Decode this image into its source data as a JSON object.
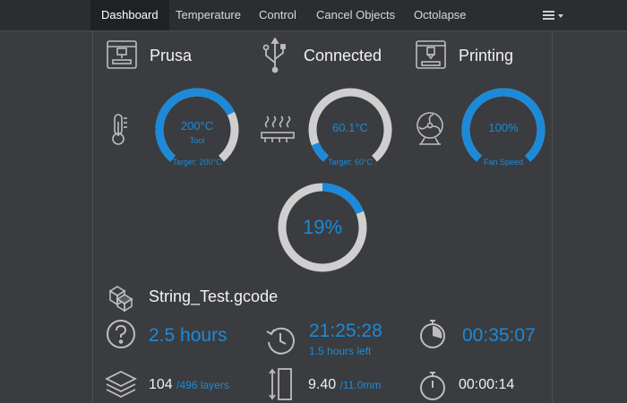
{
  "nav": {
    "tabs": [
      {
        "label": "Dashboard",
        "active": true
      },
      {
        "label": "Temperature"
      },
      {
        "label": "Control"
      },
      {
        "label": "Cancel Objects"
      },
      {
        "label": "Octolapse"
      }
    ],
    "menu_icon": "hamburger-dropdown-icon"
  },
  "status": {
    "printer_name": "Prusa",
    "connection": "Connected",
    "state": "Printing"
  },
  "gauges": {
    "tool": {
      "value": "200°C",
      "sub": "Tool",
      "target": "Target: 200°C",
      "fill": 0.73
    },
    "bed": {
      "value": "60.1°C",
      "target": "Target: 60°C",
      "fill": 0.1
    },
    "fan": {
      "value": "100%",
      "target": "Fan Speed",
      "fill": 1.0
    }
  },
  "progress": {
    "value": "19%",
    "fill": 0.19
  },
  "job": {
    "filename": "String_Test.gcode",
    "estimated_total": "2.5 hours",
    "eta_clock": "21:25:28",
    "time_left": "1.5 hours left",
    "elapsed": "00:35:07",
    "layer_current": "104",
    "layer_total": "/496 layers",
    "height_current": "9.40",
    "height_total": "/11.0mm",
    "layer_time": "00:00:14"
  },
  "colors": {
    "accent": "#1c8ad8",
    "track": "#cfcfcf",
    "background": "#3a3c3f"
  }
}
